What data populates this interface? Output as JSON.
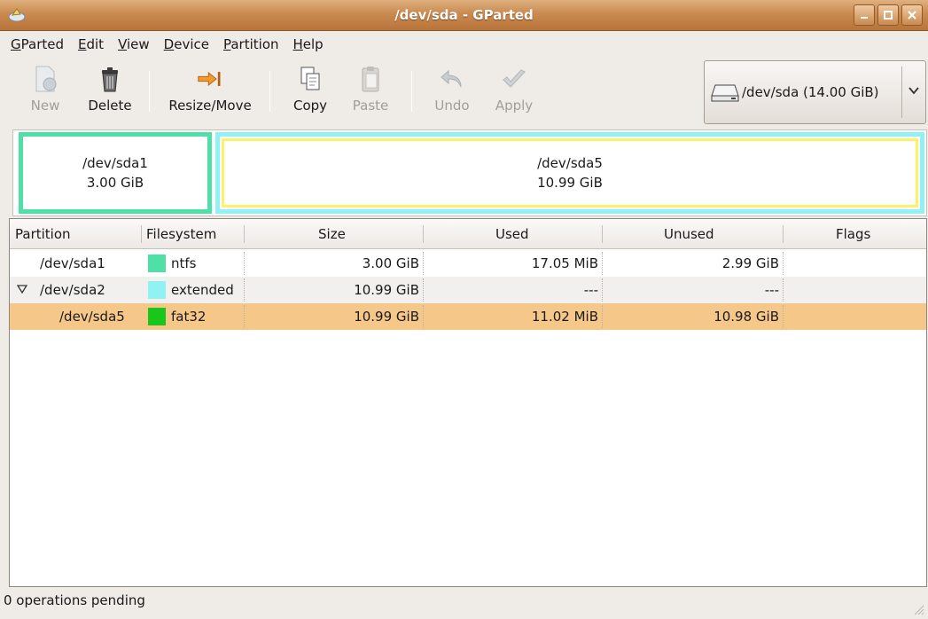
{
  "window": {
    "title": "/dev/sda - GParted"
  },
  "menu": [
    {
      "label": "GParted",
      "mnemonic": "G",
      "rest": "Parted"
    },
    {
      "label": "Edit",
      "mnemonic": "E",
      "rest": "dit"
    },
    {
      "label": "View",
      "mnemonic": "V",
      "rest": "iew"
    },
    {
      "label": "Device",
      "mnemonic": "D",
      "rest": "evice"
    },
    {
      "label": "Partition",
      "mnemonic": "P",
      "rest": "artition"
    },
    {
      "label": "Help",
      "mnemonic": "H",
      "rest": "elp"
    }
  ],
  "toolbar": {
    "new": "New",
    "delete": "Delete",
    "resize_move": "Resize/Move",
    "copy": "Copy",
    "paste": "Paste",
    "undo": "Undo",
    "apply": "Apply"
  },
  "device": {
    "label": "/dev/sda  (14.00 GiB)"
  },
  "graph": {
    "sda1": {
      "name": "/dev/sda1",
      "size": "3.00 GiB"
    },
    "sda5": {
      "name": "/dev/sda5",
      "size": "10.99 GiB"
    }
  },
  "table": {
    "headers": [
      "Partition",
      "Filesystem",
      "Size",
      "Used",
      "Unused",
      "Flags"
    ],
    "rows": [
      {
        "partition": "/dev/sda1",
        "filesystem": "ntfs",
        "fs_color": "#4ee0a6",
        "size": "3.00 GiB",
        "used": "17.05 MiB",
        "unused": "2.99 GiB",
        "flags": ""
      },
      {
        "partition": "/dev/sda2",
        "filesystem": "extended",
        "fs_color": "#8ff3f3",
        "size": "10.99 GiB",
        "used": "---",
        "unused": "---",
        "flags": ""
      },
      {
        "partition": "/dev/sda5",
        "filesystem": "fat32",
        "fs_color": "#17c81a",
        "size": "10.99 GiB",
        "used": "11.02 MiB",
        "unused": "10.98 GiB",
        "flags": ""
      }
    ]
  },
  "status": {
    "text": "0 operations pending"
  },
  "colors": {
    "titlebar": "#c98a50",
    "selection": "#f5c88a",
    "ntfs": "#4ee0a6",
    "extended": "#8ff3f3",
    "fat32": "#17c81a",
    "selection_outline": "#fbf26a"
  }
}
